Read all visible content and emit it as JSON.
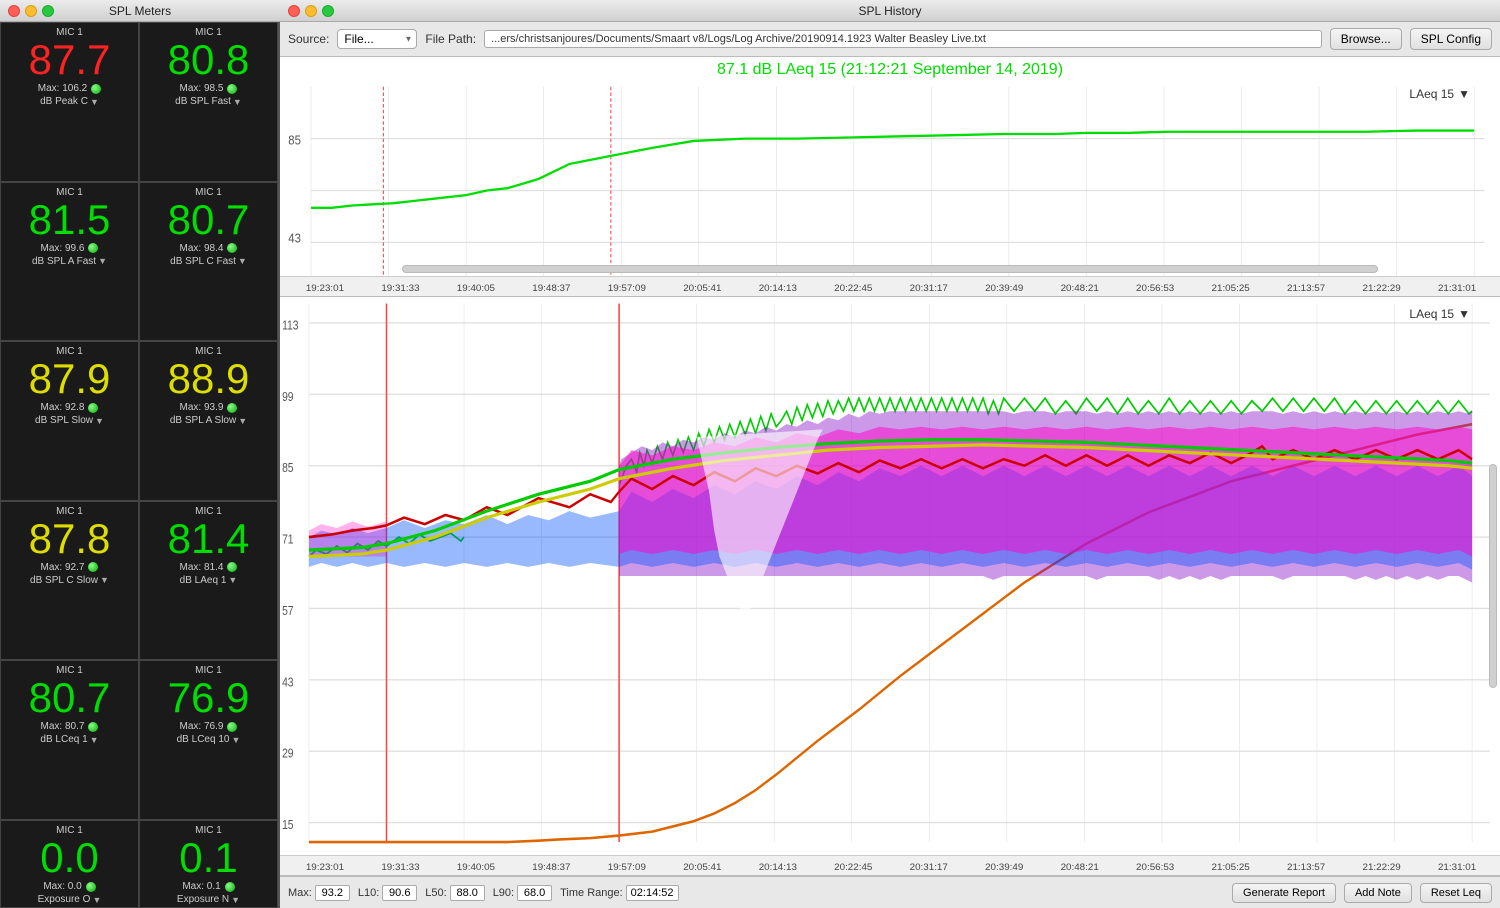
{
  "windows": {
    "spl_meters": {
      "title": "SPL Meters"
    },
    "spl_history": {
      "title": "SPL History"
    }
  },
  "toolbar": {
    "source_label": "Source:",
    "source_value": "File...",
    "filepath_label": "File Path:",
    "filepath_value": "...ers/christsanjoures/Documents/Smaart v8/Logs/Log Archive/20190914.1923 Walter Beasley Live.txt",
    "browse_label": "Browse...",
    "spl_config_label": "SPL Config"
  },
  "chart1": {
    "title": "87.1 dB LAeq 15 (21:12:21 September 14, 2019)",
    "legend": "LAeq 15",
    "y_labels": [
      "85",
      "43"
    ],
    "time_labels": [
      "19:23:01",
      "19:31:33",
      "19:40:05",
      "19:48:37",
      "19:57:09",
      "20:05:41",
      "20:14:13",
      "20:22:45",
      "20:31:17",
      "20:39:49",
      "20:48:21",
      "20:56:53",
      "21:05:25",
      "21:13:57",
      "21:22:29",
      "21:31:01"
    ]
  },
  "chart2": {
    "legend": "LAeq 15",
    "y_labels": [
      "113",
      "99",
      "85",
      "71",
      "57",
      "43",
      "29",
      "15"
    ],
    "time_labels": [
      "19:23:01",
      "19:31:33",
      "19:40:05",
      "19:48:37",
      "19:57:09",
      "20:05:41",
      "20:14:13",
      "20:22:45",
      "20:31:17",
      "20:39:49",
      "20:48:21",
      "20:56:53",
      "21:05:25",
      "21:13:57",
      "21:22:29",
      "21:31:01"
    ]
  },
  "status_bar": {
    "max_label": "Max:",
    "max_value": "93.2",
    "l10_label": "L10:",
    "l10_value": "90.6",
    "l50_label": "L50:",
    "l50_value": "88.0",
    "l90_label": "L90:",
    "l90_value": "68.0",
    "time_range_label": "Time Range:",
    "time_range_value": "02:14:52",
    "generate_report": "Generate Report",
    "add_note": "Add Note",
    "reset_leq": "Reset Leq"
  },
  "meters": [
    {
      "label": "MIC 1",
      "value": "87.7",
      "color": "red",
      "max_label": "Max: 106.2",
      "type": "dB Peak C"
    },
    {
      "label": "MIC 1",
      "value": "80.8",
      "color": "green",
      "max_label": "Max: 98.5",
      "type": "dB SPL Fast"
    },
    {
      "label": "MIC 1",
      "value": "81.5",
      "color": "green",
      "max_label": "Max: 99.6",
      "type": "dB SPL A Fast"
    },
    {
      "label": "MIC 1",
      "value": "80.7",
      "color": "green",
      "max_label": "Max: 98.4",
      "type": "dB SPL C Fast"
    },
    {
      "label": "MIC 1",
      "value": "87.9",
      "color": "yellow",
      "max_label": "Max: 92.8",
      "type": "dB SPL Slow"
    },
    {
      "label": "MIC 1",
      "value": "88.9",
      "color": "yellow",
      "max_label": "Max: 93.9",
      "type": "dB SPL A Slow"
    },
    {
      "label": "MIC 1",
      "value": "87.8",
      "color": "yellow",
      "max_label": "Max: 92.7",
      "type": "dB SPL C Slow"
    },
    {
      "label": "MIC 1",
      "value": "81.4",
      "color": "green",
      "max_label": "Max: 81.4",
      "type": "dB LAeq 1"
    },
    {
      "label": "MIC 1",
      "value": "80.7",
      "color": "green",
      "max_label": "Max: 80.7",
      "type": "dB LCeq 1"
    },
    {
      "label": "MIC 1",
      "value": "76.9",
      "color": "green",
      "max_label": "Max: 76.9",
      "type": "dB LCeq 10"
    },
    {
      "label": "MIC 1",
      "value": "0.0",
      "color": "green",
      "max_label": "Max: 0.0",
      "type": "Exposure O"
    },
    {
      "label": "MIC 1",
      "value": "0.1",
      "color": "green",
      "max_label": "Max: 0.1",
      "type": "Exposure N"
    }
  ]
}
